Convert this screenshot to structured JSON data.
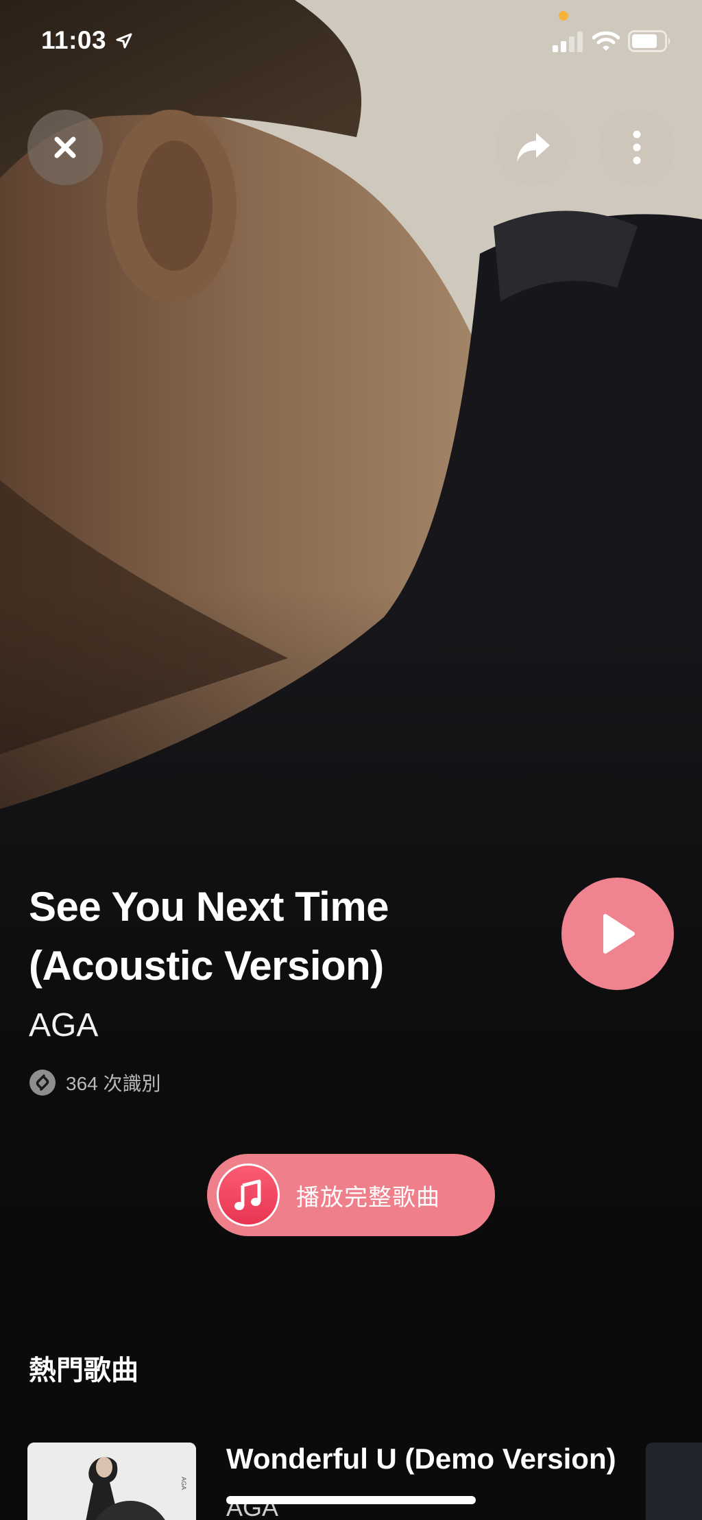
{
  "status_bar": {
    "time": "11:03",
    "icons": [
      "location-arrow-icon",
      "cellular-signal-icon",
      "wifi-icon",
      "battery-icon"
    ]
  },
  "header": {
    "icons": [
      "close-icon",
      "share-icon",
      "more-icon"
    ]
  },
  "song": {
    "title_line1": "See You Next Time",
    "title_line2": "(Acoustic Version)",
    "artist": "AGA",
    "shazam_count": "364 次識別"
  },
  "actions": {
    "play_full_song": "播放完整歌曲"
  },
  "top_songs": {
    "heading": "熱門歌曲",
    "items": [
      {
        "title": "Wonderful U (Demo Version)",
        "artist": "AGA"
      }
    ]
  },
  "colors": {
    "accent": "#f08390",
    "apple_music": "#fb5c74",
    "privacy_dot": "#f5b33a",
    "background": "#0b0b0c"
  }
}
